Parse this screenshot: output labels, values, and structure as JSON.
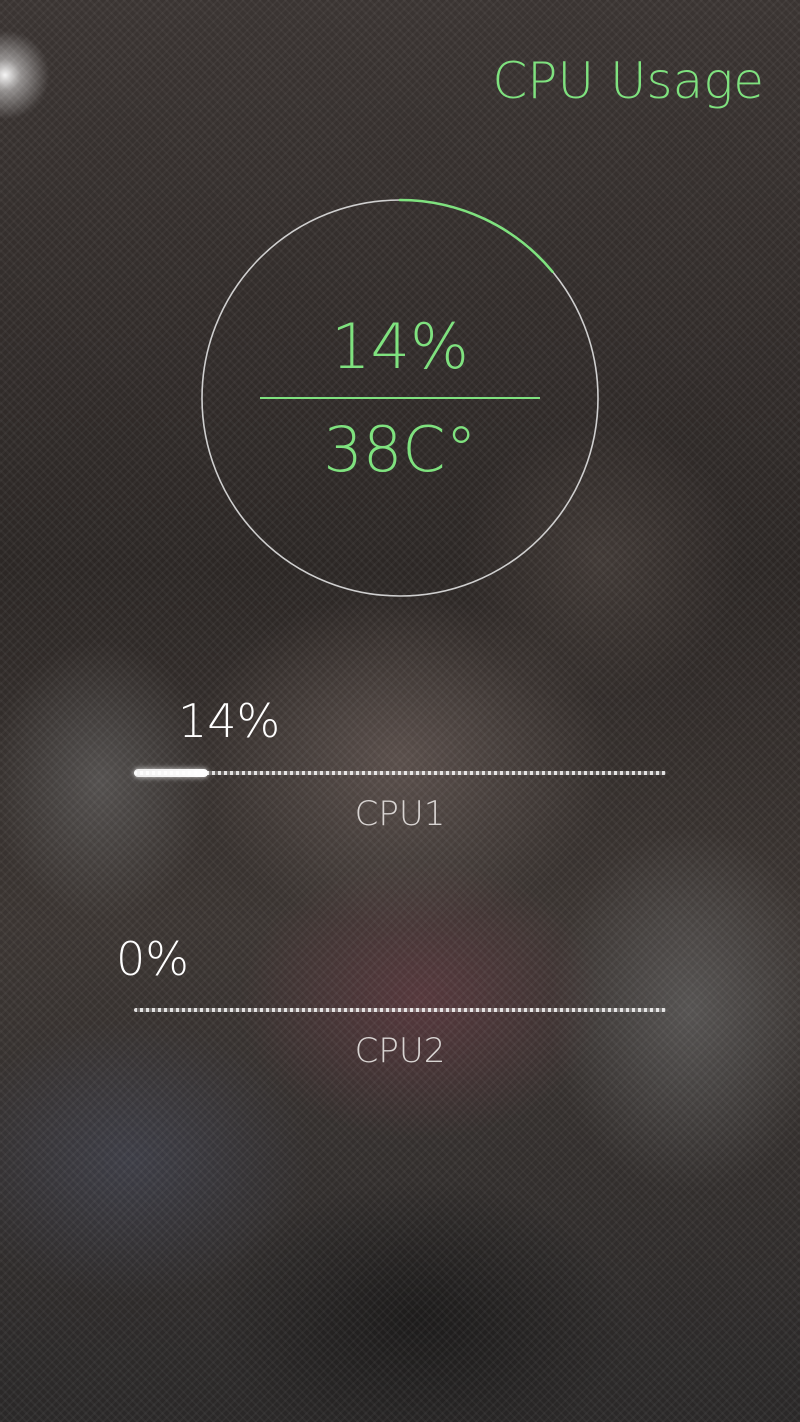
{
  "header": {
    "title": "CPU Usage"
  },
  "gauge": {
    "usage_text": "14%",
    "usage_fraction": 0.14,
    "temperature_text": "38C°"
  },
  "cores": [
    {
      "label": "CPU1",
      "value_text": "14%",
      "value": 14
    },
    {
      "label": "CPU2",
      "value_text": "0%",
      "value": 0
    }
  ],
  "colors": {
    "accent": "#7fe27f",
    "ring": "#cfcfcf",
    "text": "#ffffff"
  }
}
